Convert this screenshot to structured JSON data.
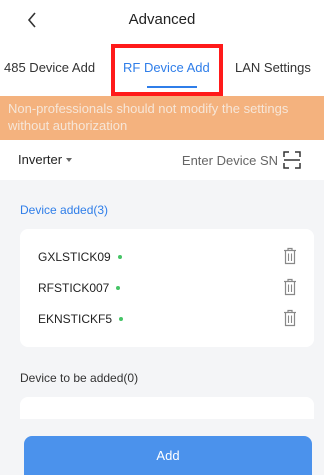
{
  "header": {
    "title": "Advanced"
  },
  "tabs": [
    {
      "label": "485 Device Add",
      "active": false
    },
    {
      "label": "RF Device Add",
      "active": true
    },
    {
      "label": "LAN Settings",
      "active": false
    }
  ],
  "warning": {
    "text": "Non-professionals should not modify the settings without authorization"
  },
  "device_entry": {
    "type_label": "Inverter",
    "sn_placeholder": "Enter Device SN"
  },
  "added": {
    "label": "Device added(3)",
    "devices": [
      {
        "name": "GXLSTICK09",
        "status": "online"
      },
      {
        "name": "RFSTICK007",
        "status": "online"
      },
      {
        "name": "EKNSTICKF5",
        "status": "online"
      }
    ]
  },
  "to_be_added": {
    "label": "Device to be added(0)"
  },
  "add_button_label": "Add",
  "colors": {
    "accent": "#2f7ee9",
    "warning_bg": "#f4b27e",
    "highlight": "#ff1a1a",
    "online": "#45c466",
    "button": "#4b92ec"
  }
}
